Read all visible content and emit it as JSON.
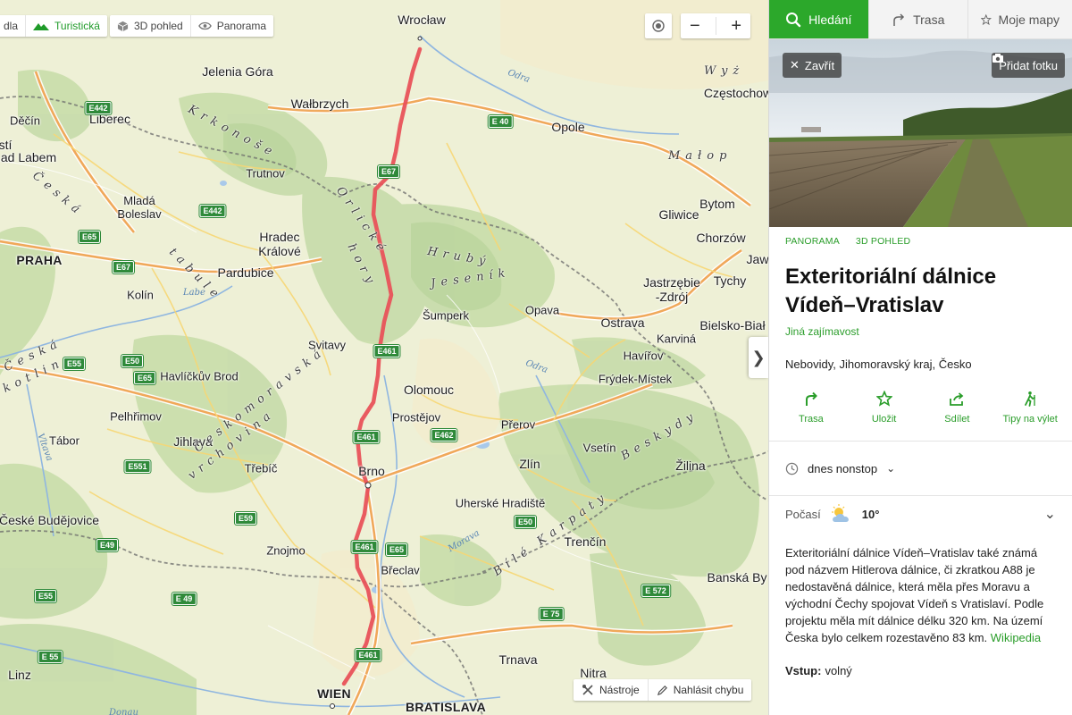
{
  "map": {
    "layers": {
      "partial_label": "dla",
      "tourist": "Turistická",
      "view3d": "3D pohled",
      "panorama": "Panorama"
    },
    "zoom_out": "−",
    "zoom_in": "+",
    "tools": "Nástroje",
    "report_error": "Nahlásit chybu",
    "colors": {
      "route": "#e8525a",
      "forest": "#c8dcaa",
      "highway": "#f0a040"
    },
    "places": [
      {
        "id": "wroclaw",
        "text": "Wrocław"
      },
      {
        "id": "jelenia",
        "text": "Jelenia Góra"
      },
      {
        "id": "walbrzych",
        "text": "Wałbrzych"
      },
      {
        "id": "czestochowa",
        "text": "Częstochow"
      },
      {
        "id": "decin",
        "text": "Děčín"
      },
      {
        "id": "liberec",
        "text": "Liberec"
      },
      {
        "id": "opole",
        "text": "Opole"
      },
      {
        "id": "usti",
        "text": "ad Labem"
      },
      {
        "id": "usti2",
        "text": "stí"
      },
      {
        "id": "trutnov",
        "text": "Trutnov"
      },
      {
        "id": "mlada",
        "text": "Mladá\nBoleslav"
      },
      {
        "id": "gliwice",
        "text": "Gliwice"
      },
      {
        "id": "bytom",
        "text": "Bytom"
      },
      {
        "id": "chorzow",
        "text": "Chorzów"
      },
      {
        "id": "jaw",
        "text": "Jaw"
      },
      {
        "id": "praha",
        "text": "PRAHA"
      },
      {
        "id": "hradec",
        "text": "Hradec\nKrálové"
      },
      {
        "id": "pardubice",
        "text": "Pardubice"
      },
      {
        "id": "jastrzebie",
        "text": "Jastrzębie\n-Zdrój"
      },
      {
        "id": "tychy",
        "text": "Tychy"
      },
      {
        "id": "kolin",
        "text": "Kolín"
      },
      {
        "id": "sumperk",
        "text": "Šumperk"
      },
      {
        "id": "opava",
        "text": "Opava"
      },
      {
        "id": "ostrava",
        "text": "Ostrava"
      },
      {
        "id": "bielsko",
        "text": "Bielsko-Biał"
      },
      {
        "id": "svitavy",
        "text": "Svitavy"
      },
      {
        "id": "karvina",
        "text": "Karviná"
      },
      {
        "id": "havlickuv",
        "text": "Havlíčkův Brod"
      },
      {
        "id": "havirov",
        "text": "Havířov"
      },
      {
        "id": "frydek",
        "text": "Frýdek-Místek"
      },
      {
        "id": "olomouc",
        "text": "Olomouc"
      },
      {
        "id": "pelhrimov",
        "text": "Pelhřimov"
      },
      {
        "id": "prostejov",
        "text": "Prostějov"
      },
      {
        "id": "prerov",
        "text": "Přerov"
      },
      {
        "id": "tabor",
        "text": "Tábor"
      },
      {
        "id": "jihlava",
        "text": "Jihlava"
      },
      {
        "id": "vsetin",
        "text": "Vsetín"
      },
      {
        "id": "trebic",
        "text": "Třebíč"
      },
      {
        "id": "brno",
        "text": "Brno"
      },
      {
        "id": "zlin",
        "text": "Zlín"
      },
      {
        "id": "zilina",
        "text": "Žilina"
      },
      {
        "id": "uherske",
        "text": "Uherské Hradiště"
      },
      {
        "id": "budejovice",
        "text": "České Budějovice"
      },
      {
        "id": "znojmo",
        "text": "Znojmo"
      },
      {
        "id": "trencin",
        "text": "Trenčín"
      },
      {
        "id": "breclav",
        "text": "Břeclav"
      },
      {
        "id": "banska",
        "text": "Banská By"
      },
      {
        "id": "linz",
        "text": "Linz"
      },
      {
        "id": "trnava",
        "text": "Trnava"
      },
      {
        "id": "nitra",
        "text": "Nitra"
      },
      {
        "id": "wien",
        "text": "WIEN"
      },
      {
        "id": "bratislava",
        "text": "BRATISLAVA"
      }
    ],
    "regions": [
      {
        "id": "krkonose",
        "text": "Krkonoše"
      },
      {
        "id": "orlicke",
        "text": "Orlické"
      },
      {
        "id": "hory",
        "text": "hory"
      },
      {
        "id": "hruby",
        "text": "Hrubý"
      },
      {
        "id": "jesenik",
        "text": "Jeseník"
      },
      {
        "id": "malop",
        "text": "Małop"
      },
      {
        "id": "wyz",
        "text": "Wyż"
      },
      {
        "id": "ceska",
        "text": "Česká"
      },
      {
        "id": "tabule",
        "text": "tabule"
      },
      {
        "id": "ceskomor",
        "text": "Českomoravská"
      },
      {
        "id": "vrchovina",
        "text": "vrchovina"
      },
      {
        "id": "ceska2",
        "text": "Česká"
      },
      {
        "id": "kotlina",
        "text": "kotlina"
      },
      {
        "id": "beskydy",
        "text": "Beskydy"
      },
      {
        "id": "karpaty",
        "text": "Bílé Karpaty"
      }
    ],
    "rivers": [
      {
        "id": "odra",
        "text": "Odra"
      },
      {
        "id": "labe",
        "text": "Labe"
      },
      {
        "id": "odra2",
        "text": "Odra"
      },
      {
        "id": "morava",
        "text": "Morava"
      },
      {
        "id": "vltava",
        "text": "Vltava"
      },
      {
        "id": "dunaj",
        "text": "Donau"
      }
    ],
    "shields": [
      {
        "id": "e442a",
        "text": "E442"
      },
      {
        "id": "e40",
        "text": "E 40"
      },
      {
        "id": "e442b",
        "text": "E442"
      },
      {
        "id": "e65a",
        "text": "E65"
      },
      {
        "id": "e67",
        "text": "E67"
      },
      {
        "id": "e55a",
        "text": "E55"
      },
      {
        "id": "e50a",
        "text": "E50"
      },
      {
        "id": "e65b",
        "text": "E65"
      },
      {
        "id": "e462",
        "text": "E462"
      },
      {
        "id": "e551",
        "text": "E551"
      },
      {
        "id": "e59",
        "text": "E59"
      },
      {
        "id": "e50b",
        "text": "E50"
      },
      {
        "id": "e49a",
        "text": "E49"
      },
      {
        "id": "e65c",
        "text": "E65"
      },
      {
        "id": "e55b",
        "text": "E55"
      },
      {
        "id": "e49b",
        "text": "E 49"
      },
      {
        "id": "e572",
        "text": "E 572"
      },
      {
        "id": "e75",
        "text": "E 75"
      },
      {
        "id": "e55c",
        "text": "E 55"
      },
      {
        "id": "e461a",
        "text": "E461"
      },
      {
        "id": "e461b",
        "text": "E461"
      },
      {
        "id": "e461c",
        "text": "E461"
      },
      {
        "id": "e461d",
        "text": "E461"
      },
      {
        "id": "e67b",
        "text": "E67"
      }
    ]
  },
  "panel": {
    "tabs": {
      "search": "Hledání",
      "route": "Trasa",
      "mymaps": "Moje mapy"
    },
    "close": "Zavřít",
    "add_photo": "Přidat fotku",
    "chips": {
      "panorama": "PANORAMA",
      "view3d": "3D POHLED"
    },
    "title": "Exteritoriální dálnice Vídeň–Vratislav",
    "category": "Jiná zajímavost",
    "address": "Nebovidy, Jihomoravský kraj, Česko",
    "actions": {
      "route": "Trasa",
      "save": "Uložit",
      "share": "Sdílet",
      "trip": "Tipy na výlet"
    },
    "hours": "dnes nonstop",
    "weather_label": "Počasí",
    "temperature": "10°",
    "description": "Exteritoriální dálnice Vídeň–Vratislav také známá pod názvem Hitlerova dálnice, či zkratkou A88 je nedostavěná dálnice, která měla přes Moravu a východní Čechy spojovat Vídeň s Vratislaví. Podle projektu měla mít dálnice délku 320 km. Na území Česka bylo celkem rozestavěno 83 km.",
    "wiki_link": "Wikipedia",
    "entry_label": "Vstup:",
    "entry_value": "volný",
    "accent": "#2ca82b"
  }
}
